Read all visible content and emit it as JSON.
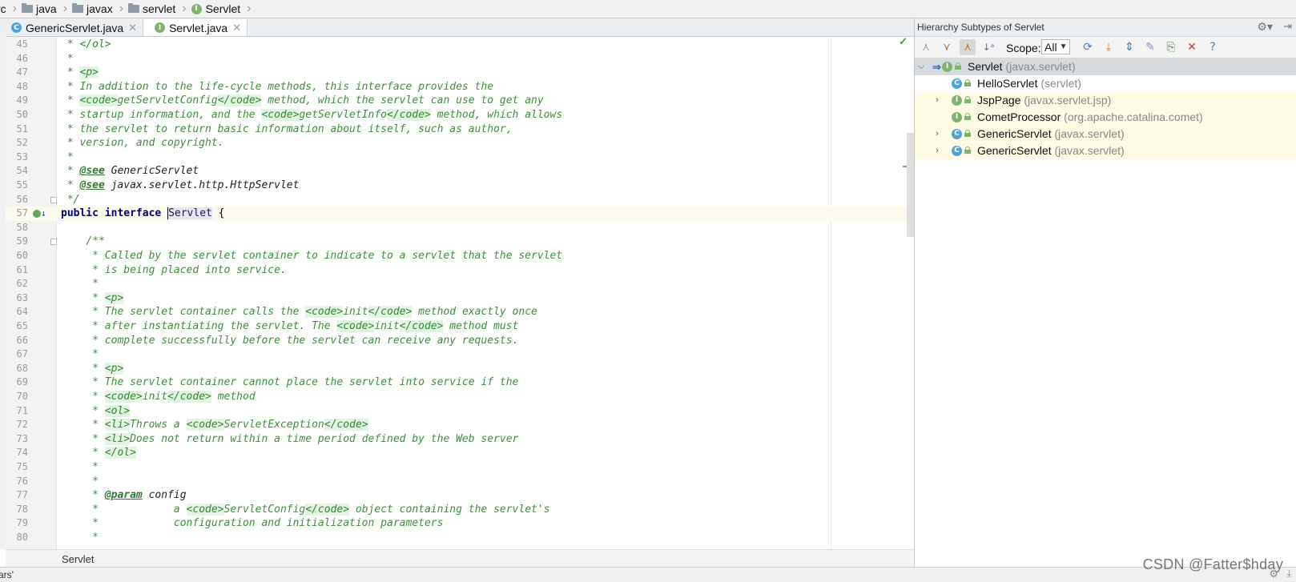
{
  "breadcrumb": {
    "items": [
      {
        "label": "rc",
        "icon": "none"
      },
      {
        "label": "java",
        "icon": "folder-icon"
      },
      {
        "label": "javax",
        "icon": "folder-icon"
      },
      {
        "label": "servlet",
        "icon": "folder-icon"
      },
      {
        "label": "Servlet",
        "icon": "interface-icon"
      }
    ]
  },
  "tabs": [
    {
      "label": "GenericServlet.java",
      "badge": "C",
      "active": false
    },
    {
      "label": "Servlet.java",
      "badge": "I",
      "active": true
    }
  ],
  "editor": {
    "footer_breadcrumb": "Servlet",
    "lines": [
      {
        "n": "45",
        "html": "<span class=\"doc\"> * </span><span class=\"tagtext\">&lt;/ol&gt;</span>"
      },
      {
        "n": "46",
        "html": "<span class=\"doc\"> *</span>"
      },
      {
        "n": "47",
        "html": "<span class=\"doc\"> * </span><span class=\"tag\">&lt;p&gt;</span>"
      },
      {
        "n": "48",
        "html": "<span class=\"doc\"> * In addition to the life-cycle methods, this interface provides the</span>"
      },
      {
        "n": "49",
        "html": "<span class=\"doc\"> * </span><span class=\"tag\">&lt;code&gt;</span><span class=\"doc\">getServletConfig</span><span class=\"tag\">&lt;/code&gt;</span><span class=\"doc\"> method, which the servlet can use to get any</span>"
      },
      {
        "n": "50",
        "html": "<span class=\"doc\"> * startup information, and the </span><span class=\"tag\">&lt;code&gt;</span><span class=\"doc\">getServletInfo</span><span class=\"tag\">&lt;/code&gt;</span><span class=\"doc\"> method, which allows</span>"
      },
      {
        "n": "51",
        "html": "<span class=\"doc\"> * the servlet to return basic information about itself, such as author,</span>"
      },
      {
        "n": "52",
        "html": "<span class=\"doc\"> * version, and copyright.</span>"
      },
      {
        "n": "53",
        "html": "<span class=\"doc\"> *</span>"
      },
      {
        "n": "54",
        "html": "<span class=\"doc\"> * </span><span class=\"doctag\">@see</span><span class=\"docref\"> GenericServlet</span>"
      },
      {
        "n": "55",
        "html": "<span class=\"doc\"> * </span><span class=\"doctag\">@see</span><span class=\"docref\"> javax.servlet.http.HttpServlet</span>"
      },
      {
        "n": "56",
        "html": "<span class=\"doc\"> */</span>"
      },
      {
        "n": "57",
        "html": "<span class=\"kw\">public interface </span><span class=\"ident-hl\"><span class=\"caret\"></span>Servlet</span><span class=\"plain\"> {</span>",
        "current": true
      },
      {
        "n": "58",
        "html": ""
      },
      {
        "n": "59",
        "html": "<span class=\"doc\">    /**</span>"
      },
      {
        "n": "60",
        "html": "<span class=\"doc\">     * Called by the servlet container to indicate to a servlet that the servlet</span>"
      },
      {
        "n": "61",
        "html": "<span class=\"doc\">     * is being placed into service.</span>"
      },
      {
        "n": "62",
        "html": "<span class=\"doc\">     *</span>"
      },
      {
        "n": "63",
        "html": "<span class=\"doc\">     * </span><span class=\"tag\">&lt;p&gt;</span>"
      },
      {
        "n": "64",
        "html": "<span class=\"doc\">     * The servlet container calls the </span><span class=\"tag\">&lt;code&gt;</span><span class=\"doc\">init</span><span class=\"tag\">&lt;/code&gt;</span><span class=\"doc\"> method exactly once</span>"
      },
      {
        "n": "65",
        "html": "<span class=\"doc\">     * after instantiating the servlet. The </span><span class=\"tag\">&lt;code&gt;</span><span class=\"doc\">init</span><span class=\"tag\">&lt;/code&gt;</span><span class=\"doc\"> method must</span>"
      },
      {
        "n": "66",
        "html": "<span class=\"doc\">     * complete successfully before the servlet can receive any requests.</span>"
      },
      {
        "n": "67",
        "html": "<span class=\"doc\">     *</span>"
      },
      {
        "n": "68",
        "html": "<span class=\"doc\">     * </span><span class=\"tag\">&lt;p&gt;</span>"
      },
      {
        "n": "69",
        "html": "<span class=\"doc\">     * The servlet container cannot place the servlet into service if the</span>"
      },
      {
        "n": "70",
        "html": "<span class=\"doc\">     * </span><span class=\"tag\">&lt;code&gt;</span><span class=\"doc\">init</span><span class=\"tag\">&lt;/code&gt;</span><span class=\"doc\"> method</span>"
      },
      {
        "n": "71",
        "html": "<span class=\"doc\">     * </span><span class=\"tag\">&lt;ol&gt;</span>"
      },
      {
        "n": "72",
        "html": "<span class=\"doc\">     * </span><span class=\"tag\">&lt;li&gt;</span><span class=\"doc\">Throws a </span><span class=\"tag\">&lt;code&gt;</span><span class=\"doc\">ServletException</span><span class=\"tag\">&lt;/code&gt;</span>"
      },
      {
        "n": "73",
        "html": "<span class=\"doc\">     * </span><span class=\"tag\">&lt;li&gt;</span><span class=\"doc\">Does not return within a time period defined by the Web server</span>"
      },
      {
        "n": "74",
        "html": "<span class=\"doc\">     * </span><span class=\"tag\">&lt;/ol&gt;</span>"
      },
      {
        "n": "75",
        "html": "<span class=\"doc\">     *</span>"
      },
      {
        "n": "76",
        "html": "<span class=\"doc\">     *</span>"
      },
      {
        "n": "77",
        "html": "<span class=\"doc\">     * </span><span class=\"doctag\">@param</span><span class=\"docref\"> config</span>"
      },
      {
        "n": "78",
        "html": "<span class=\"doc\">     *            a </span><span class=\"tag\">&lt;code&gt;</span><span class=\"doc\">ServletConfig</span><span class=\"tag\">&lt;/code&gt;</span><span class=\"doc\"> object containing the servlet's</span>"
      },
      {
        "n": "79",
        "html": "<span class=\"doc\">     *            configuration and initialization parameters</span>"
      },
      {
        "n": "80",
        "html": "<span class=\"doc\">     *</span>"
      }
    ]
  },
  "hierarchy": {
    "title": "Hierarchy Subtypes of Servlet",
    "scope_label": "Scope:",
    "scope_value": "All",
    "nodes": [
      {
        "name": "Servlet",
        "pkg": "(javax.servlet)",
        "badge": "I",
        "selected": true,
        "expander": "down",
        "level": 0
      },
      {
        "name": "HelloServlet",
        "pkg": "(servlet)",
        "badge": "C",
        "expander": "",
        "level": 1
      },
      {
        "name": "JspPage",
        "pkg": "(javax.servlet.jsp)",
        "badge": "I",
        "expander": "right",
        "level": 1,
        "tinted": true
      },
      {
        "name": "CometProcessor",
        "pkg": "(org.apache.catalina.comet)",
        "badge": "I",
        "expander": "",
        "level": 1,
        "tinted": true
      },
      {
        "name": "GenericServlet",
        "pkg": "(javax.servlet)",
        "badge": "C",
        "expander": "right",
        "level": 1,
        "tinted": true
      },
      {
        "name": "GenericServlet",
        "pkg": "(javax.servlet)",
        "badge": "C",
        "expander": "right",
        "level": 1,
        "tinted": true
      }
    ]
  },
  "statusbar": {
    "text": "ars'"
  },
  "watermark": "CSDN @Fatter$hday",
  "colors": {
    "doc_comment": "#3d8f3d",
    "keyword": "#000080",
    "interface_badge": "#7fb56a",
    "class_badge": "#4ea5d9",
    "selection": "#d6dbe0"
  }
}
